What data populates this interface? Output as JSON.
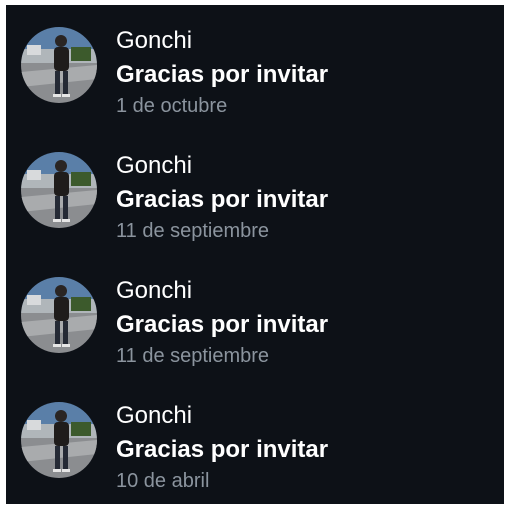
{
  "messages": [
    {
      "sender": "Gonchi",
      "text": "Gracias por invitar",
      "date": "1 de octubre"
    },
    {
      "sender": "Gonchi",
      "text": "Gracias por invitar",
      "date": "11 de septiembre"
    },
    {
      "sender": "Gonchi",
      "text": "Gracias por invitar",
      "date": "11 de septiembre"
    },
    {
      "sender": "Gonchi",
      "text": "Gracias por invitar",
      "date": "10 de abril"
    }
  ],
  "colors": {
    "background": "#0d1117",
    "primary_text": "#ffffff",
    "secondary_text": "#8b949e"
  }
}
